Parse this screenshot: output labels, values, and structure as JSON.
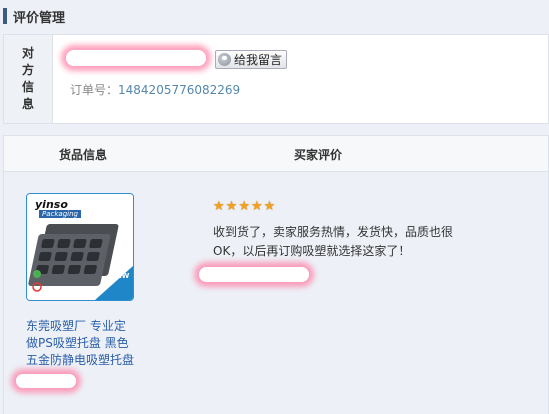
{
  "section": {
    "title": "评价管理"
  },
  "counterparty": {
    "label": "对方信息",
    "label_chars": [
      "对",
      "方",
      "信",
      "息"
    ],
    "message_button": "给我留言",
    "order_label": "订单号：",
    "order_number": "1484205776082269"
  },
  "evaluation": {
    "col_goods": "货品信息",
    "col_buyer_review": "买家评价",
    "product": {
      "title_lines": [
        "东莞吸塑厂 专业定",
        "做PS吸塑托盘 黑色",
        "五金防静电吸塑托盘"
      ],
      "image_brand": "yinso",
      "image_sub": "Packaging",
      "image_badge": "NEW"
    },
    "rating": 5,
    "review_lines": [
      "收到货了，卖家服务热情，发货快，品质也很",
      "OK，以后再订购吸塑就选择这家了！"
    ]
  },
  "colors": {
    "accent_bar": "#3d5a80",
    "link": "#2a5ea8",
    "star": "#f2a01f"
  },
  "icons": [
    "message-icon",
    "star-icon"
  ]
}
